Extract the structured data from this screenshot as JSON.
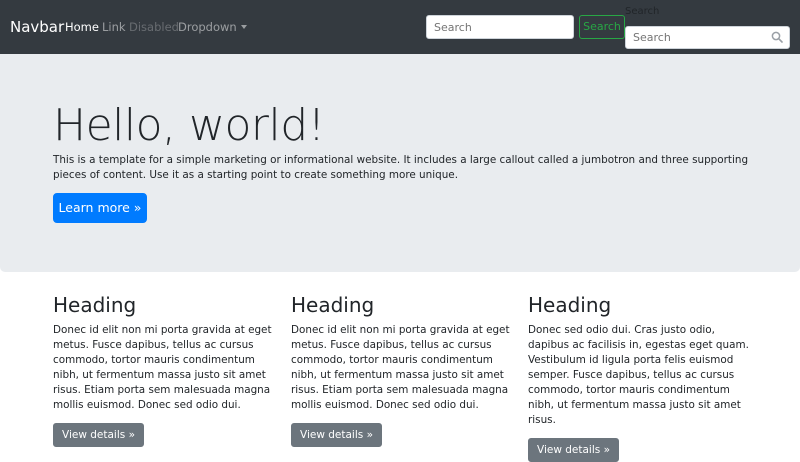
{
  "navbar": {
    "brand": "Navbar",
    "links": [
      "Home",
      "Link",
      "Disabled",
      "Dropdown"
    ],
    "search_form": {
      "placeholder": "Search",
      "button_label": "Search"
    },
    "search_box": {
      "label": "Search",
      "placeholder": "Search",
      "icon": "search-icon"
    }
  },
  "jumbotron": {
    "title": "Hello, world!",
    "text": "This is a template for a simple marketing or informational website. It includes a large callout called a jumbotron and three supporting pieces of content. Use it as a starting point to create something more unique.",
    "button_label": "Learn more »"
  },
  "columns": [
    {
      "heading": "Heading",
      "text": "Donec id elit non mi porta gravida at eget metus. Fusce dapibus, tellus ac cursus commodo, tortor mauris condimentum nibh, ut fermentum massa justo sit amet risus. Etiam porta sem malesuada magna mollis euismod. Donec sed odio dui.",
      "button_label": "View details »"
    },
    {
      "heading": "Heading",
      "text": "Donec id elit non mi porta gravida at eget metus. Fusce dapibus, tellus ac cursus commodo, tortor mauris condimentum nibh, ut fermentum massa justo sit amet risus. Etiam porta sem malesuada magna mollis euismod. Donec sed odio dui.",
      "button_label": "View details »"
    },
    {
      "heading": "Heading",
      "text": "Donec sed odio dui. Cras justo odio, dapibus ac facilisis in, egestas eget quam. Vestibulum id ligula porta felis euismod semper. Fusce dapibus, tellus ac cursus commodo, tortor mauris condimentum nibh, ut fermentum massa justo sit amet risus.",
      "button_label": "View details »"
    }
  ],
  "colors": {
    "navbar_bg": "#343a40",
    "jumbotron_bg": "#e9ecef",
    "primary": "#007bff",
    "success": "#28a745",
    "secondary": "#6c757d"
  }
}
